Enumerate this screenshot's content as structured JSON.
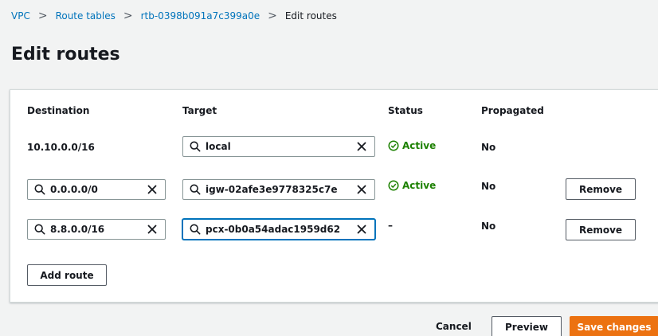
{
  "breadcrumb": {
    "items": [
      "VPC",
      "Route tables",
      "rtb-0398b091a7c399a0e"
    ],
    "current": "Edit routes",
    "separator": ">"
  },
  "page": {
    "title": "Edit routes"
  },
  "table": {
    "headers": {
      "destination": "Destination",
      "target": "Target",
      "status": "Status",
      "propagated": "Propagated"
    },
    "rows": [
      {
        "destination": "10.10.0.0/16",
        "target": "local",
        "status": "Active",
        "propagated": "No",
        "remove": ""
      },
      {
        "destination": "0.0.0.0/0",
        "target": "igw-02afe3e9778325c7e",
        "status": "Active",
        "propagated": "No",
        "remove": "Remove"
      },
      {
        "destination": "8.8.0.0/16",
        "target": "pcx-0b0a54adac1959d62",
        "status": "–",
        "propagated": "No",
        "remove": "Remove"
      }
    ]
  },
  "actions": {
    "add_route": "Add route"
  },
  "footer": {
    "cancel": "Cancel",
    "preview": "Preview",
    "save": "Save changes"
  },
  "colors": {
    "link": "#0073bb",
    "active": "#1d8102",
    "primary": "#ec7211",
    "focus": "#0073bb"
  },
  "icons": {
    "field_leading": "search-icon",
    "field_trailing": "clear-icon",
    "status": "check-circle-icon"
  }
}
